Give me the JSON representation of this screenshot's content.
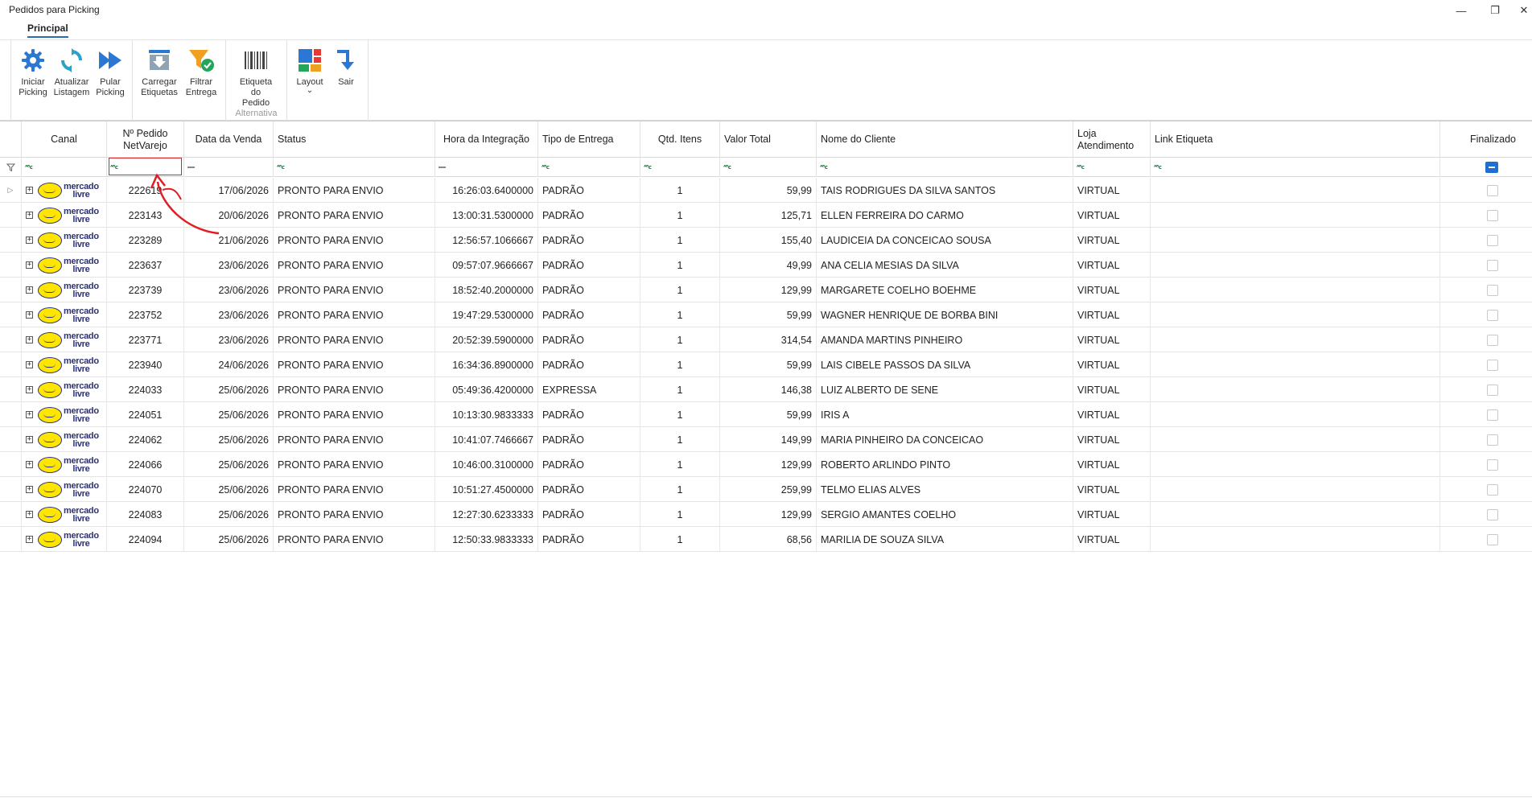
{
  "window": {
    "title": "Pedidos para Picking",
    "minimize_icon": "minimize-icon",
    "restore_icon": "restore-icon",
    "close_icon": "close-icon"
  },
  "ribbon": {
    "tab": "Principal",
    "buttons": {
      "iniciar": "Iniciar\nPicking",
      "atualizar": "Atualizar\nListagem",
      "pular": "Pular\nPicking",
      "carregar": "Carregar\nEtiquetas",
      "filtrar": "Filtrar\nEntrega",
      "etiqueta": "Etiqueta\ndo Pedido",
      "layout": "Layout",
      "layout_arrow": "⌄",
      "sair": "Sair"
    },
    "group_caption": "Alternativa",
    "colors": {
      "blue": "#2b78d4",
      "orange": "#f0a020",
      "green": "#23a55a"
    }
  },
  "grid": {
    "columns": {
      "canal": "Canal",
      "pedido": "Nº Pedido\nNetVarejo",
      "data": "Data da Venda",
      "status": "Status",
      "hora": "Hora da Integração",
      "tipo": "Tipo de Entrega",
      "qtd": "Qtd. Itens",
      "valor": "Valor Total",
      "cliente": "Nome do Cliente",
      "loja": "Loja\nAtendimento",
      "link": "Link Etiqueta",
      "finalizado": "Finalizado"
    },
    "filter_abc": "ᴬᴮc",
    "logo_text": "mercado\nlivre",
    "rows": [
      {
        "pedido": "222619",
        "data": "17/06/2026",
        "status": "PRONTO PARA ENVIO",
        "hora": "16:26:03.6400000",
        "tipo": "PADRÃO",
        "qtd": "1",
        "valor": "59,99",
        "cliente": "TAIS RODRIGUES DA SILVA SANTOS",
        "loja": "VIRTUAL"
      },
      {
        "pedido": "223143",
        "data": "20/06/2026",
        "status": "PRONTO PARA ENVIO",
        "hora": "13:00:31.5300000",
        "tipo": "PADRÃO",
        "qtd": "1",
        "valor": "125,71",
        "cliente": "ELLEN FERREIRA DO CARMO",
        "loja": "VIRTUAL"
      },
      {
        "pedido": "223289",
        "data": "21/06/2026",
        "status": "PRONTO PARA ENVIO",
        "hora": "12:56:57.1066667",
        "tipo": "PADRÃO",
        "qtd": "1",
        "valor": "155,40",
        "cliente": "LAUDICEIA DA CONCEICAO SOUSA",
        "loja": "VIRTUAL"
      },
      {
        "pedido": "223637",
        "data": "23/06/2026",
        "status": "PRONTO PARA ENVIO",
        "hora": "09:57:07.9666667",
        "tipo": "PADRÃO",
        "qtd": "1",
        "valor": "49,99",
        "cliente": "ANA CELIA MESIAS DA SILVA",
        "loja": "VIRTUAL"
      },
      {
        "pedido": "223739",
        "data": "23/06/2026",
        "status": "PRONTO PARA ENVIO",
        "hora": "18:52:40.2000000",
        "tipo": "PADRÃO",
        "qtd": "1",
        "valor": "129,99",
        "cliente": "MARGARETE COELHO BOEHME",
        "loja": "VIRTUAL"
      },
      {
        "pedido": "223752",
        "data": "23/06/2026",
        "status": "PRONTO PARA ENVIO",
        "hora": "19:47:29.5300000",
        "tipo": "PADRÃO",
        "qtd": "1",
        "valor": "59,99",
        "cliente": "WAGNER HENRIQUE DE BORBA BINI",
        "loja": "VIRTUAL"
      },
      {
        "pedido": "223771",
        "data": "23/06/2026",
        "status": "PRONTO PARA ENVIO",
        "hora": "20:52:39.5900000",
        "tipo": "PADRÃO",
        "qtd": "1",
        "valor": "314,54",
        "cliente": "AMANDA MARTINS PINHEIRO",
        "loja": "VIRTUAL"
      },
      {
        "pedido": "223940",
        "data": "24/06/2026",
        "status": "PRONTO PARA ENVIO",
        "hora": "16:34:36.8900000",
        "tipo": "PADRÃO",
        "qtd": "1",
        "valor": "59,99",
        "cliente": "LAIS CIBELE PASSOS DA SILVA",
        "loja": "VIRTUAL"
      },
      {
        "pedido": "224033",
        "data": "25/06/2026",
        "status": "PRONTO PARA ENVIO",
        "hora": "05:49:36.4200000",
        "tipo": "EXPRESSA",
        "qtd": "1",
        "valor": "146,38",
        "cliente": "LUIZ ALBERTO DE SENE",
        "loja": "VIRTUAL"
      },
      {
        "pedido": "224051",
        "data": "25/06/2026",
        "status": "PRONTO PARA ENVIO",
        "hora": "10:13:30.9833333",
        "tipo": "PADRÃO",
        "qtd": "1",
        "valor": "59,99",
        "cliente": "IRIS A",
        "loja": "VIRTUAL"
      },
      {
        "pedido": "224062",
        "data": "25/06/2026",
        "status": "PRONTO PARA ENVIO",
        "hora": "10:41:07.7466667",
        "tipo": "PADRÃO",
        "qtd": "1",
        "valor": "149,99",
        "cliente": "MARIA PINHEIRO DA CONCEICAO",
        "loja": "VIRTUAL"
      },
      {
        "pedido": "224066",
        "data": "25/06/2026",
        "status": "PRONTO PARA ENVIO",
        "hora": "10:46:00.3100000",
        "tipo": "PADRÃO",
        "qtd": "1",
        "valor": "129,99",
        "cliente": "ROBERTO ARLINDO PINTO",
        "loja": "VIRTUAL"
      },
      {
        "pedido": "224070",
        "data": "25/06/2026",
        "status": "PRONTO PARA ENVIO",
        "hora": "10:51:27.4500000",
        "tipo": "PADRÃO",
        "qtd": "1",
        "valor": "259,99",
        "cliente": "TELMO ELIAS ALVES",
        "loja": "VIRTUAL"
      },
      {
        "pedido": "224083",
        "data": "25/06/2026",
        "status": "PRONTO PARA ENVIO",
        "hora": "12:27:30.6233333",
        "tipo": "PADRÃO",
        "qtd": "1",
        "valor": "129,99",
        "cliente": "SERGIO AMANTES COELHO",
        "loja": "VIRTUAL"
      },
      {
        "pedido": "224094",
        "data": "25/06/2026",
        "status": "PRONTO PARA ENVIO",
        "hora": "12:50:33.9833333",
        "tipo": "PADRÃO",
        "qtd": "1",
        "valor": "68,56",
        "cliente": "MARILIA DE SOUZA SILVA",
        "loja": "VIRTUAL"
      }
    ]
  }
}
